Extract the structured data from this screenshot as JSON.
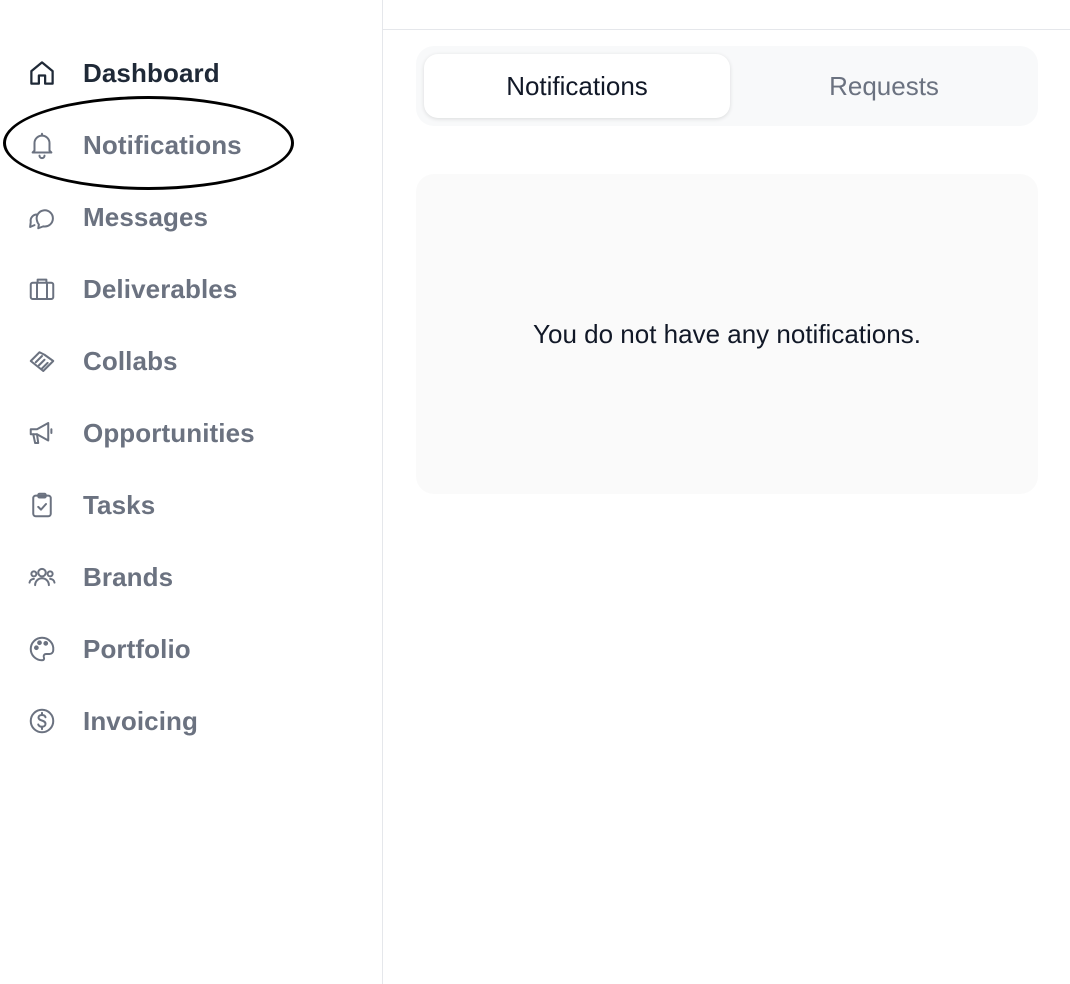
{
  "sidebar": {
    "items": [
      {
        "label": "Dashboard",
        "icon": "home-icon",
        "active": true
      },
      {
        "label": "Notifications",
        "icon": "bell-icon",
        "active": false
      },
      {
        "label": "Messages",
        "icon": "chat-bubbles-icon",
        "active": false
      },
      {
        "label": "Deliverables",
        "icon": "briefcase-icon",
        "active": false
      },
      {
        "label": "Collabs",
        "icon": "handshake-icon",
        "active": false
      },
      {
        "label": "Opportunities",
        "icon": "megaphone-icon",
        "active": false
      },
      {
        "label": "Tasks",
        "icon": "clipboard-check-icon",
        "active": false
      },
      {
        "label": "Brands",
        "icon": "users-icon",
        "active": false
      },
      {
        "label": "Portfolio",
        "icon": "palette-icon",
        "active": false
      },
      {
        "label": "Invoicing",
        "icon": "dollar-circle-icon",
        "active": false
      }
    ]
  },
  "main": {
    "tabs": [
      {
        "label": "Notifications",
        "active": true
      },
      {
        "label": "Requests",
        "active": false
      }
    ],
    "empty_state": "You do not have any notifications."
  },
  "colors": {
    "text_active": "#1f2937",
    "text_muted": "#6b7280",
    "annotation": "#000000"
  }
}
